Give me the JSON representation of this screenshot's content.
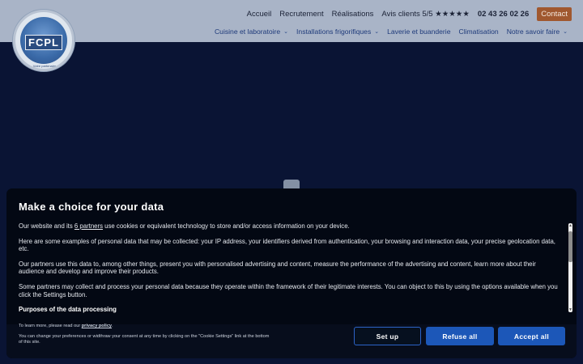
{
  "header": {
    "logo_text": "FCPL",
    "logo_subtext": "Votre partenaire",
    "top_links": [
      "Accueil",
      "Recrutement",
      "Réalisations"
    ],
    "reviews_label": "Avis clients 5/5",
    "stars": "★★★★★",
    "phone": "02 43 26 02 26",
    "contact_label": "Contact",
    "main_nav": [
      {
        "label": "Cuisine et laboratoire",
        "chevron": "⌄"
      },
      {
        "label": "Installations frigorifiques",
        "chevron": "⌄"
      },
      {
        "label": "Laverie et buanderie",
        "chevron": ""
      },
      {
        "label": "Climatisation",
        "chevron": ""
      },
      {
        "label": "Notre savoir faire",
        "chevron": "⌄"
      }
    ]
  },
  "consent": {
    "title": "Make a choice for your data",
    "p1_pre": "Our website and its ",
    "p1_link": "6 partners",
    "p1_post": " use cookies or equivalent technology to store and/or access information on your device.",
    "p2": "Here are some examples of personal data that may be collected: your IP address, your identifiers derived from authentication, your browsing and interaction data, your precise geolocation data, etc.",
    "p3": "Our partners use this data to, among other things, present you with personalised advertising and content, measure the performance of the advertising and content, learn more about their audience and develop and improve their products.",
    "p4": "Some partners may collect and process your personal data because they operate within the framework of their legitimate interests. You can object to this by using the options available when you click the Settings button.",
    "section_heading": "Purposes of the data processing",
    "learn_more_pre": "To learn more, please read our ",
    "learn_more_link": "privacy policy",
    "learn_more_post": ".",
    "change_prefs": "You can change your preferences or widthraw your consent at any time by clicking on the \"Cookie Settings\" link at the bottom of this site.",
    "btn_setup": "Set up",
    "btn_refuse": "Refuse all",
    "btn_accept": "Accept all"
  }
}
